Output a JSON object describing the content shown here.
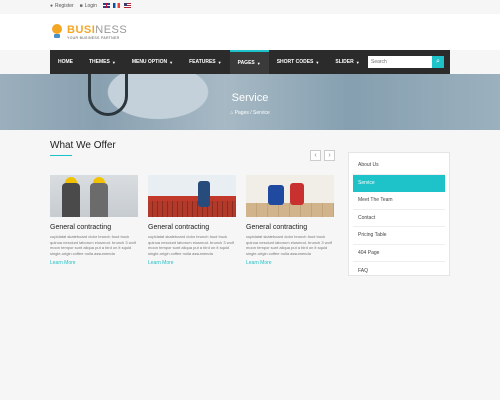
{
  "topbar": {
    "register": "Register",
    "login": "Login",
    "flags": [
      "uk",
      "fr",
      "us"
    ]
  },
  "logo": {
    "brand_highlight": "BUSI",
    "brand_rest": "NESS",
    "tagline": "YOUR BUSINESS PARTNER"
  },
  "nav": {
    "items": [
      {
        "label": "HOME",
        "caret": false
      },
      {
        "label": "THEMES",
        "caret": true
      },
      {
        "label": "MENU OPTION",
        "caret": true
      },
      {
        "label": "FEATURES",
        "caret": true
      },
      {
        "label": "PAGES",
        "caret": true
      },
      {
        "label": "SHORT CODES",
        "caret": true
      },
      {
        "label": "SLIDER",
        "caret": true
      }
    ],
    "active_index": 4,
    "search_placeholder": "Search"
  },
  "banner": {
    "title": "Service",
    "breadcrumb_home": "Pages",
    "breadcrumb_sep": "/",
    "breadcrumb_current": "Service"
  },
  "section": {
    "title": "What We Offer"
  },
  "cards": [
    {
      "title": "General contracting",
      "text": "cupidatat skateboard dolor brunch food truck quinoa nesciunt laborum eiusmod. brunch 3 wolf moon tempor sunt aliqua put a bird on it squid single-origin coffee nulla assumenda",
      "more": "Learn More"
    },
    {
      "title": "General contracting",
      "text": "cupidatat skateboard dolor brunch food truck quinoa nesciunt laborum eiusmod. brunch 3 wolf moon tempor sunt aliqua put a bird on it squid single-origin coffee nulla assumenda",
      "more": "Learn More"
    },
    {
      "title": "General contracting",
      "text": "cupidatat skateboard dolor brunch food truck quinoa nesciunt laborum eiusmod. brunch 3 wolf moon tempor sunt aliqua put a bird on it squid single-origin coffee nulla assumenda",
      "more": "Learn More"
    }
  ],
  "sidebar": {
    "items": [
      {
        "label": "About Us"
      },
      {
        "label": "Service"
      },
      {
        "label": "Meet The Team"
      },
      {
        "label": "Contact"
      },
      {
        "label": "Pricing Table"
      },
      {
        "label": "404 Page"
      },
      {
        "label": "FAQ"
      }
    ],
    "active_index": 1
  },
  "colors": {
    "accent": "#1ec2c9",
    "nav_bg": "#2b2b2b",
    "logo_orange": "#f4a623"
  }
}
